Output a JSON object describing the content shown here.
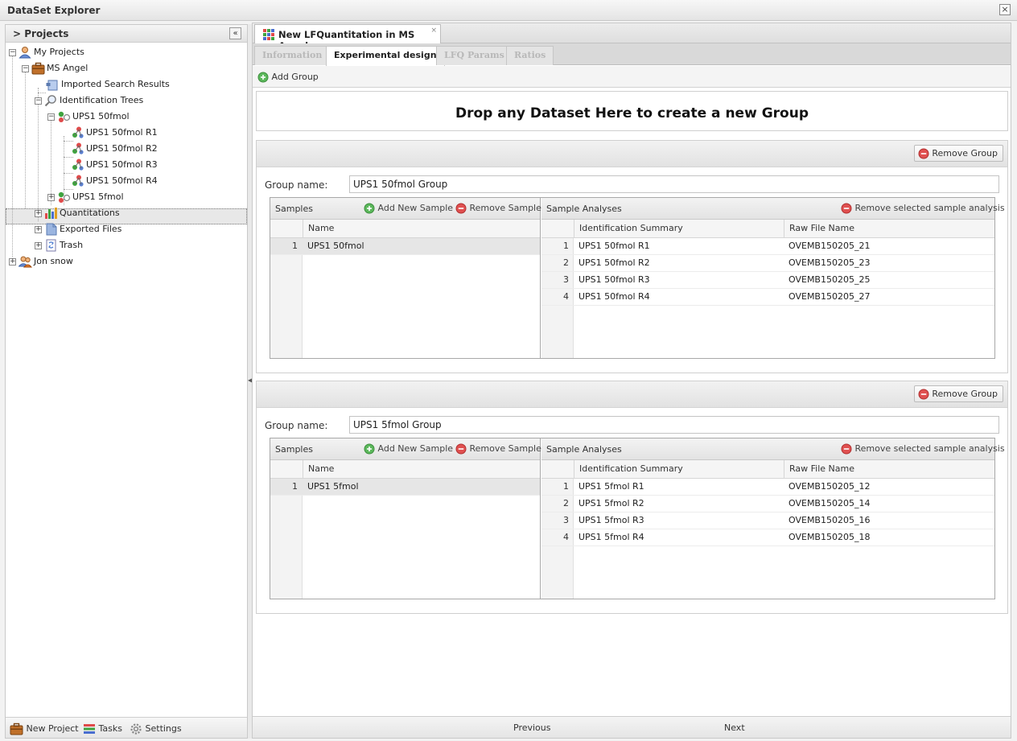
{
  "window": {
    "title": "DataSet Explorer",
    "close_label": "×"
  },
  "explorer": {
    "title": "> Projects",
    "collapse_label": "«",
    "tree": [
      {
        "label": "My Projects",
        "icon": "user-icon",
        "expander": "−"
      },
      {
        "label": "MS Angel",
        "icon": "briefcase-icon",
        "expander": "−"
      },
      {
        "label": "Imported Search Results",
        "icon": "imported-results-icon"
      },
      {
        "label": "Identification Trees",
        "icon": "magnifier-icon",
        "expander": "−"
      },
      {
        "label": "UPS1 50fmol",
        "icon": "identification-dataset-icon",
        "expander": "−"
      },
      {
        "label": "UPS1 50fmol R1",
        "icon": "molecule-icon"
      },
      {
        "label": "UPS1 50fmol R2",
        "icon": "molecule-icon"
      },
      {
        "label": "UPS1 50fmol R3",
        "icon": "molecule-icon"
      },
      {
        "label": "UPS1 50fmol R4",
        "icon": "molecule-icon"
      },
      {
        "label": "UPS1 5fmol",
        "icon": "identification-dataset-icon",
        "expander": "+"
      },
      {
        "label": "Quantitations",
        "icon": "bar-chart-icon",
        "expander": "+"
      },
      {
        "label": "Exported Files",
        "icon": "exported-files-icon",
        "expander": "+"
      },
      {
        "label": "Trash",
        "icon": "trash-icon",
        "expander": "+"
      },
      {
        "label": "Jon snow",
        "icon": "users-icon",
        "expander": "+"
      }
    ],
    "footer": {
      "new_project": "New Project",
      "tasks": "Tasks",
      "settings": "Settings"
    }
  },
  "document": {
    "tab_label": "New LFQuantitation in MS Angel",
    "tab_close": "×",
    "subtabs": [
      {
        "label": "Information",
        "active": false
      },
      {
        "label": "Experimental design",
        "active": true
      },
      {
        "label": "LFQ Params",
        "active": false
      },
      {
        "label": "Ratios",
        "active": false
      }
    ],
    "add_group_label": "Add Group",
    "drop_zone_text": "Drop any Dataset Here to create a new Group",
    "groups": [
      {
        "remove_group_label": "Remove Group",
        "name_label": "Group name:",
        "name_value": "UPS1 50fmol Group",
        "samples_title": "Samples",
        "add_sample_label": "Add New Sample",
        "remove_sample_label": "Remove Sample",
        "samples_col": "Name",
        "samples": [
          {
            "n": "1",
            "name": "UPS1 50fmol"
          }
        ],
        "analyses_title": "Sample Analyses",
        "remove_analysis_label": "Remove selected sample analysis",
        "analyses_cols": [
          "Identification Summary",
          "Raw File Name"
        ],
        "analyses": [
          {
            "n": "1",
            "summary": "UPS1 50fmol R1",
            "raw": "OVEMB150205_21"
          },
          {
            "n": "2",
            "summary": "UPS1 50fmol R2",
            "raw": "OVEMB150205_23"
          },
          {
            "n": "3",
            "summary": "UPS1 50fmol R3",
            "raw": "OVEMB150205_25"
          },
          {
            "n": "4",
            "summary": "UPS1 50fmol R4",
            "raw": "OVEMB150205_27"
          }
        ]
      },
      {
        "remove_group_label": "Remove Group",
        "name_label": "Group name:",
        "name_value": "UPS1 5fmol Group",
        "samples_title": "Samples",
        "add_sample_label": "Add New Sample",
        "remove_sample_label": "Remove Sample",
        "samples_col": "Name",
        "samples": [
          {
            "n": "1",
            "name": "UPS1 5fmol"
          }
        ],
        "analyses_title": "Sample Analyses",
        "remove_analysis_label": "Remove selected sample analysis",
        "analyses_cols": [
          "Identification Summary",
          "Raw File Name"
        ],
        "analyses": [
          {
            "n": "1",
            "summary": "UPS1 5fmol R1",
            "raw": "OVEMB150205_12"
          },
          {
            "n": "2",
            "summary": "UPS1 5fmol R2",
            "raw": "OVEMB150205_14"
          },
          {
            "n": "3",
            "summary": "UPS1 5fmol R3",
            "raw": "OVEMB150205_16"
          },
          {
            "n": "4",
            "summary": "UPS1 5fmol R4",
            "raw": "OVEMB150205_18"
          }
        ]
      }
    ],
    "nav": {
      "previous": "Previous",
      "next": "Next"
    }
  },
  "colors": {
    "add": "#4caf50",
    "remove": "#e04040",
    "selection": "#e6e6e6"
  }
}
